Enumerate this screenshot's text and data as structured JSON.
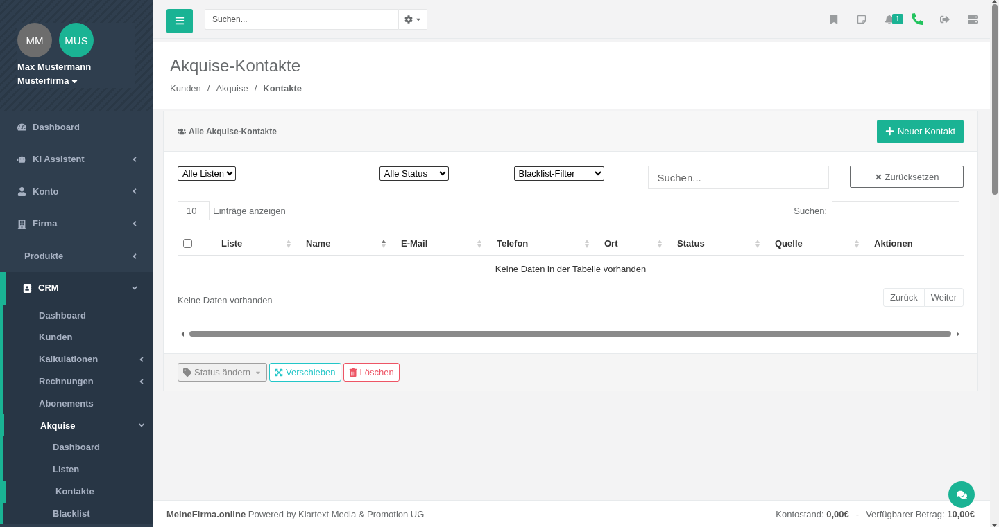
{
  "sidebar": {
    "profile": {
      "avatars": [
        {
          "initials": "MM",
          "color": "#6d6d6d"
        },
        {
          "initials": "MUS",
          "color": "#1ab394"
        }
      ],
      "name": "Max Mustermann",
      "company": "Musterfirma"
    },
    "items": [
      {
        "label": "Dashboard",
        "kind": "link",
        "selected": false
      },
      {
        "label": "KI Assistent",
        "kind": "submenu",
        "expanded": false,
        "selected": false
      },
      {
        "label": "Konto",
        "kind": "submenu",
        "expanded": false,
        "selected": false
      },
      {
        "label": "Firma",
        "kind": "submenu",
        "expanded": false,
        "selected": false
      },
      {
        "label": "Produkte",
        "kind": "submenu",
        "expanded": false,
        "selected": false
      },
      {
        "label": "CRM",
        "kind": "submenu",
        "expanded": true,
        "selected": true,
        "children": [
          {
            "label": "Dashboard",
            "kind": "link",
            "selected": false
          },
          {
            "label": "Kunden",
            "kind": "link",
            "selected": false
          },
          {
            "label": "Kalkulationen",
            "kind": "submenu",
            "expanded": false,
            "selected": false
          },
          {
            "label": "Rechnungen",
            "kind": "submenu",
            "expanded": false,
            "selected": false
          },
          {
            "label": "Abonements",
            "kind": "link",
            "selected": false
          },
          {
            "label": "Akquise",
            "kind": "submenu",
            "expanded": true,
            "selected": true,
            "children": [
              {
                "label": "Dashboard",
                "kind": "link",
                "selected": false
              },
              {
                "label": "Listen",
                "kind": "link",
                "selected": false
              },
              {
                "label": "Kontakte",
                "kind": "link",
                "selected": true
              },
              {
                "label": "Blacklist",
                "kind": "link",
                "selected": false
              }
            ]
          }
        ]
      }
    ]
  },
  "topbar": {
    "search": {
      "placeholder": "Suchen..."
    },
    "notification_count": "1"
  },
  "page_header": {
    "title": "Akquise-Kontakte",
    "breadcrumb": [
      {
        "label": "Kunden",
        "current": false
      },
      {
        "separator": "/",
        "label": "Akquise",
        "current": false
      },
      {
        "separator": "/",
        "label": "Kontakte",
        "current": true
      }
    ]
  },
  "panel": {
    "title": "Alle Akquise-Kontakte",
    "new_button": "Neuer Kontakt",
    "filters": {
      "list": "Alle Listen",
      "status": "Alle Status",
      "blacklist": "Blacklist-Filter",
      "search": {
        "placeholder": "Suchen..."
      },
      "reset_button": "Zurücksetzen"
    },
    "page_length": {
      "value": "10",
      "label": "Einträge anzeigen"
    },
    "table_search": {
      "label": "Suchen:"
    },
    "table": {
      "select_all": {
        "checked": false
      },
      "columns": [
        {
          "label": "Liste",
          "sortable": true,
          "sorted": false
        },
        {
          "label": "Name",
          "sortable": true,
          "sorted": true
        },
        {
          "label": "E-Mail",
          "sortable": true,
          "sorted": false
        },
        {
          "label": "Telefon",
          "sortable": true,
          "sorted": false
        },
        {
          "label": "Ort",
          "sortable": true,
          "sorted": false
        },
        {
          "label": "Status",
          "sortable": true,
          "sorted": false
        },
        {
          "label": "Quelle",
          "sortable": true,
          "sorted": false
        },
        {
          "label": "Aktionen",
          "sortable": false,
          "sorted": false
        }
      ],
      "empty_message": "Keine Daten in der Tabelle vorhanden"
    },
    "info": "Keine Daten vorhanden",
    "pagination": [
      {
        "label": "Zurück"
      },
      {
        "label": "Weiter"
      }
    ],
    "bulk_actions": [
      {
        "label": "Status ändern",
        "kind": "dropdown"
      },
      {
        "label": "Verschieben",
        "kind": "move"
      },
      {
        "label": "Löschen",
        "kind": "delete"
      }
    ]
  },
  "footer": {
    "left": "**MeineFirma.online** Powered by Klartext Media & Promotion UG",
    "balance": "Kontostand: **0,00€**",
    "separator": "-",
    "available": "Verfügbarer Betrag: **10,00€**"
  }
}
